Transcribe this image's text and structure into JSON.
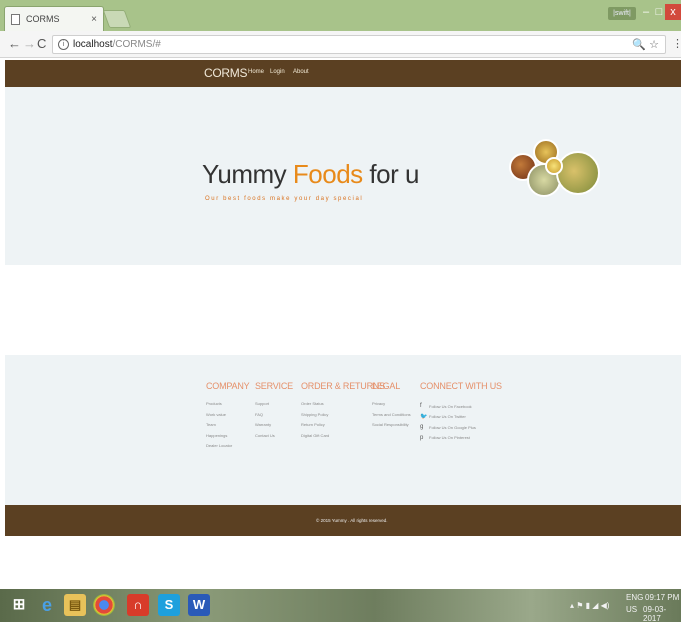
{
  "browser": {
    "tab_title": "CORMS",
    "tab_close": "×",
    "window_user": "|swift|",
    "min": "–",
    "max": "□",
    "close": "x",
    "url_host": "localhost",
    "url_path": "/CORMS/#",
    "omni_icons": "🔍 ☆",
    "menu": "⋮"
  },
  "site": {
    "brand": "CORMS",
    "nav": {
      "home": "Home",
      "login": "Login",
      "about": "About"
    },
    "hero": {
      "title_pre": "Yummy ",
      "title_accent": "Foods",
      "title_post": " for u",
      "tagline": "Our best foods make your day special"
    },
    "footer": {
      "company": {
        "heading": "COMPANY",
        "items": [
          "Products",
          "Work value",
          "Team",
          "Happenings",
          "Dealer Locator"
        ]
      },
      "service": {
        "heading": "SERVICE",
        "items": [
          "Support",
          "FAQ",
          "Warranty",
          "Contact Us"
        ]
      },
      "orders": {
        "heading": "ORDER & RETURNS",
        "items": [
          "Order Status",
          "Shipping Policy",
          "Return Policy",
          "Digital Gift Card"
        ]
      },
      "legal": {
        "heading": "LEGAL",
        "items": [
          "Privacy",
          "Terms and Conditions",
          "Social Responsibility"
        ]
      },
      "connect": {
        "heading": "CONNECT WITH US",
        "items": [
          "Follow Us On Facebook",
          "Follow Us On Twitter",
          "Follow Us On Google Plus",
          "Follow Us On Pinterest"
        ]
      }
    },
    "copyright": "© 2015 Yummy . All rights reserved."
  },
  "taskbar": {
    "lang": "ENG",
    "region": "US",
    "time": "09:17 PM",
    "date": "09-03-2017"
  },
  "colors": {
    "navbar": "#5b4022",
    "accent": "#e88a1a",
    "footer_heading": "#e5906a",
    "chrome": "#a8c38a"
  }
}
